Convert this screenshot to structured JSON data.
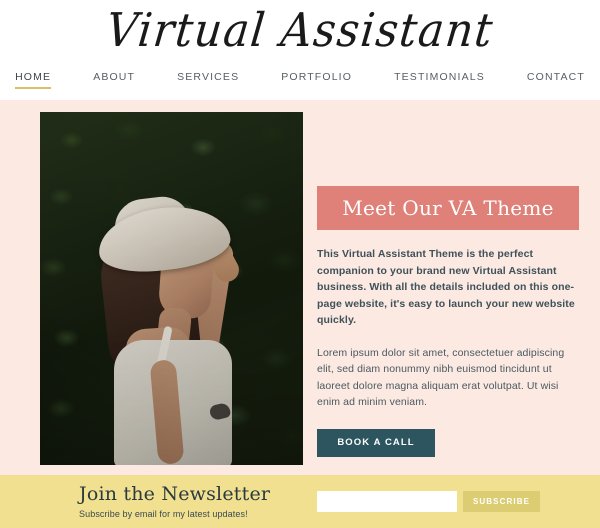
{
  "header": {
    "logo": "Virtual Assistant",
    "nav": [
      {
        "label": "HOME",
        "active": true
      },
      {
        "label": "ABOUT",
        "active": false
      },
      {
        "label": "SERVICES",
        "active": false
      },
      {
        "label": "PORTFOLIO",
        "active": false
      },
      {
        "label": "TESTIMONIALS",
        "active": false
      },
      {
        "label": "CONTACT",
        "active": false
      }
    ],
    "active_underline_color": "#d8c06a"
  },
  "hero": {
    "background_color": "#fbe9e2",
    "photo": {
      "alt": "Woman wearing a wide-brim white hat and white sundress standing in front of a dark green ivy wall",
      "icon": "hero-photo"
    },
    "banner_text": "Meet Our VA Theme",
    "banner_color": "#df8079",
    "paragraph_1": "This Virtual Assistant Theme is the perfect companion to your brand new Virtual Assistant business. With all the details included on this one-page website, it's easy to launch your new website quickly.",
    "paragraph_2": "Lorem ipsum dolor sit amet, consectetuer adipiscing elit, sed diam nonummy nibh euismod tincidunt ut laoreet dolore magna aliquam erat volutpat. Ut wisi enim ad minim veniam.",
    "cta_label": "BOOK A CALL",
    "cta_color": "#2c5560"
  },
  "newsletter": {
    "background_color": "#f0e08f",
    "title": "Join the Newsletter",
    "subtitle": "Subscribe by email for my latest updates!",
    "email_value": "",
    "email_placeholder": "",
    "submit_label": "SUBSCRIBE",
    "submit_color": "#dccd72"
  }
}
